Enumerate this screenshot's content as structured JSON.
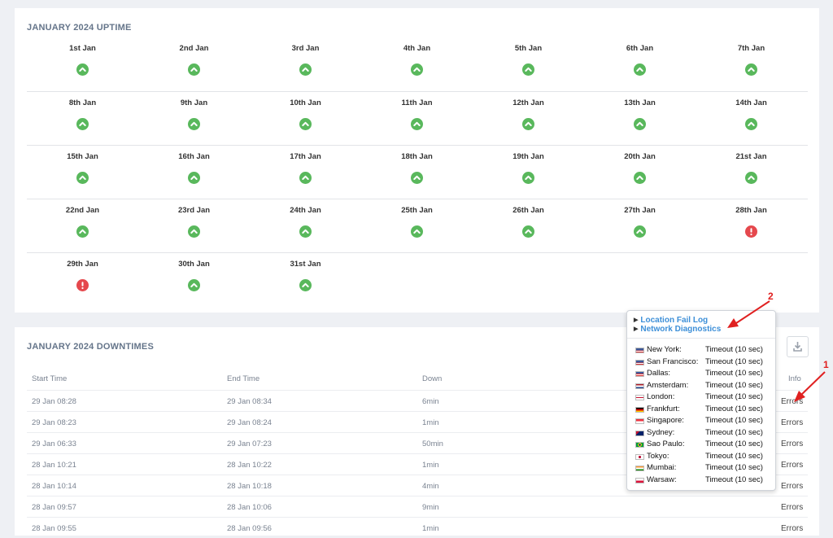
{
  "uptime": {
    "title": "JANUARY 2024 UPTIME",
    "weeks": [
      [
        {
          "label": "1st Jan",
          "status": "up"
        },
        {
          "label": "2nd Jan",
          "status": "up"
        },
        {
          "label": "3rd Jan",
          "status": "up"
        },
        {
          "label": "4th Jan",
          "status": "up"
        },
        {
          "label": "5th Jan",
          "status": "up"
        },
        {
          "label": "6th Jan",
          "status": "up"
        },
        {
          "label": "7th Jan",
          "status": "up"
        }
      ],
      [
        {
          "label": "8th Jan",
          "status": "up"
        },
        {
          "label": "9th Jan",
          "status": "up"
        },
        {
          "label": "10th Jan",
          "status": "up"
        },
        {
          "label": "11th Jan",
          "status": "up"
        },
        {
          "label": "12th Jan",
          "status": "up"
        },
        {
          "label": "13th Jan",
          "status": "up"
        },
        {
          "label": "14th Jan",
          "status": "up"
        }
      ],
      [
        {
          "label": "15th Jan",
          "status": "up"
        },
        {
          "label": "16th Jan",
          "status": "up"
        },
        {
          "label": "17th Jan",
          "status": "up"
        },
        {
          "label": "18th Jan",
          "status": "up"
        },
        {
          "label": "19th Jan",
          "status": "up"
        },
        {
          "label": "20th Jan",
          "status": "up"
        },
        {
          "label": "21st Jan",
          "status": "up"
        }
      ],
      [
        {
          "label": "22nd Jan",
          "status": "up"
        },
        {
          "label": "23rd Jan",
          "status": "up"
        },
        {
          "label": "24th Jan",
          "status": "up"
        },
        {
          "label": "25th Jan",
          "status": "up"
        },
        {
          "label": "26th Jan",
          "status": "up"
        },
        {
          "label": "27th Jan",
          "status": "up"
        },
        {
          "label": "28th Jan",
          "status": "error"
        }
      ],
      [
        {
          "label": "29th Jan",
          "status": "error"
        },
        {
          "label": "30th Jan",
          "status": "up"
        },
        {
          "label": "31st Jan",
          "status": "up"
        }
      ]
    ]
  },
  "downtimes": {
    "title": "JANUARY 2024 DOWNTIMES",
    "download_icon": "download-icon",
    "columns": [
      "Start Time",
      "End Time",
      "Down",
      "Info"
    ],
    "rows": [
      [
        "29 Jan 08:28",
        "29 Jan 08:34",
        "6min",
        "Errors"
      ],
      [
        "29 Jan 08:23",
        "29 Jan 08:24",
        "1min",
        "Errors"
      ],
      [
        "29 Jan 06:33",
        "29 Jan 07:23",
        "50min",
        "Errors"
      ],
      [
        "28 Jan 10:21",
        "28 Jan 10:22",
        "1min",
        "Errors"
      ],
      [
        "28 Jan 10:14",
        "28 Jan 10:18",
        "4min",
        "Errors"
      ],
      [
        "28 Jan 09:57",
        "28 Jan 10:06",
        "9min",
        "Errors"
      ],
      [
        "28 Jan 09:55",
        "28 Jan 09:56",
        "1min",
        "Errors"
      ]
    ]
  },
  "popover": {
    "links": [
      "Location Fail Log",
      "Network Diagnostics"
    ],
    "locations": [
      {
        "name": "New York:",
        "status": "Timeout (10 sec)",
        "flag": "us"
      },
      {
        "name": "San Francisco:",
        "status": "Timeout (10 sec)",
        "flag": "us"
      },
      {
        "name": "Dallas:",
        "status": "Timeout (10 sec)",
        "flag": "us"
      },
      {
        "name": "Amsterdam:",
        "status": "Timeout (10 sec)",
        "flag": "nl"
      },
      {
        "name": "London:",
        "status": "Timeout (10 sec)",
        "flag": "gb"
      },
      {
        "name": "Frankfurt:",
        "status": "Timeout (10 sec)",
        "flag": "de"
      },
      {
        "name": "Singapore:",
        "status": "Timeout (10 sec)",
        "flag": "sg"
      },
      {
        "name": "Sydney:",
        "status": "Timeout (10 sec)",
        "flag": "au"
      },
      {
        "name": "Sao Paulo:",
        "status": "Timeout (10 sec)",
        "flag": "br"
      },
      {
        "name": "Tokyo:",
        "status": "Timeout (10 sec)",
        "flag": "jp"
      },
      {
        "name": "Mumbai:",
        "status": "Timeout (10 sec)",
        "flag": "in"
      },
      {
        "name": "Warsaw:",
        "status": "Timeout (10 sec)",
        "flag": "pl"
      }
    ]
  },
  "annotations": [
    "1",
    "2"
  ],
  "colors": {
    "up": "#59b85c",
    "error": "#e5484d",
    "link": "#3d8fd8",
    "annotation": "#e02020"
  }
}
